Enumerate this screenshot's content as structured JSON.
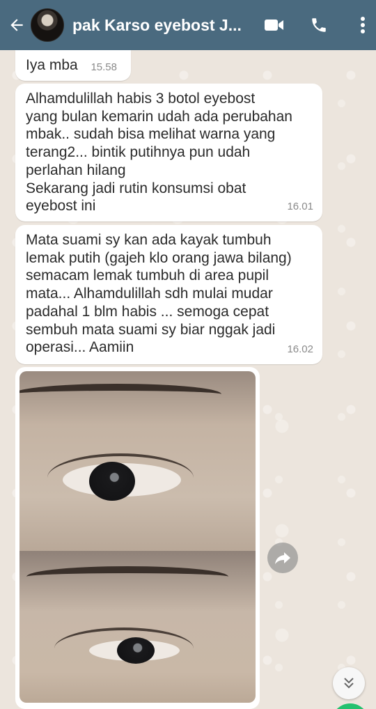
{
  "header": {
    "title": "pak Karso eyebost J...",
    "back_icon": "arrow-left-icon",
    "video_icon": "video-call-icon",
    "call_icon": "phone-icon",
    "menu_icon": "more-vert-icon",
    "color": "#4a6a7f"
  },
  "messages": [
    {
      "text": "Iya mba",
      "time": "15.58"
    },
    {
      "text": "Alhamdulillah habis 3 botol eyebost\nyang bulan kemarin udah ada perubahan\nmbak.. sudah bisa melihat warna yang\nterang2... bintik putihnya pun udah\nperlahan hilang\nSekarang jadi rutin konsumsi obat\neyebost ini",
      "time": "16.01"
    },
    {
      "text": "Mata suami sy kan ada kayak tumbuh\nlemak putih (gajeh klo orang jawa bilang)\nsemacam lemak tumbuh di area pupil\nmata... Alhamdulillah sdh mulai mudar\npadahal 1 blm habis ... semoga cepat\nsembuh mata suami sy biar nggak jadi\noperasi... Aamiin",
      "time": "16.02"
    }
  ],
  "photo_message": {
    "forward_icon": "forward-icon"
  },
  "scroll_down_icon": "double-chevron-down-icon"
}
